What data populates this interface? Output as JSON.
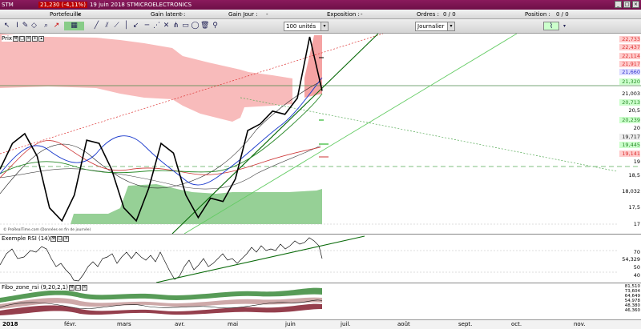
{
  "titlebar": {
    "symbol": "STM",
    "quote": "21,230 (-4,11%)",
    "info": "19 juin 2018 STMICROELECTRONICS"
  },
  "infobar": {
    "portfolio": "Portefeuille",
    "latent_gain": "Gain latent :",
    "latent_value": "-",
    "day_gain": "Gain Jour :",
    "day_value": "-",
    "exposure": "Exposition :",
    "exposure_value": "-",
    "orders": "Ordres :",
    "orders_value": "0 / 0",
    "position": "Position :",
    "position_value": "0 / 0"
  },
  "toolbar": {
    "units": "100 unités",
    "period": "Journalier"
  },
  "panels": {
    "price": "Prix",
    "rsi": "Exemple RSI (14)",
    "fibo": "Fibo_zone_rsi (9,20,2,1)",
    "credit": "© ProRealTime.com (Données en fin de journée)"
  },
  "price_axis": [
    "22,733",
    "22,437",
    "22,114",
    "21,917",
    "21,660",
    "21,320",
    "21,003",
    "20,713",
    "20,5",
    "20,239",
    "20",
    "19,717",
    "19,445",
    "19,141",
    "19",
    "18,5",
    "18,032",
    "17,5",
    "17"
  ],
  "rsi_axis": [
    "70",
    "54,329",
    "50",
    "40"
  ],
  "fibo_axis": [
    "81,510",
    "73,604",
    "64,649",
    "54,978",
    "48,380",
    "46,360"
  ],
  "months": [
    "2018",
    "févr.",
    "mars",
    "avr.",
    "mai",
    "juin",
    "juil.",
    "août",
    "sept.",
    "oct.",
    "nov."
  ],
  "chart_data": {
    "type": "line",
    "title": "STMICROELECTRONICS",
    "series": [
      {
        "name": "Prix",
        "values": [
          18.8,
          19.6,
          19.9,
          19.2,
          17.6,
          17.2,
          18.0,
          19.7,
          19.6,
          18.8,
          17.6,
          17.2,
          18.2,
          19.6,
          19.3,
          18.0,
          17.3,
          17.9,
          17.8,
          18.5,
          20.0,
          20.2,
          20.6,
          20.5,
          21.0,
          22.9,
          21.23
        ]
      }
    ],
    "ylim": [
      16.8,
      23.0
    ]
  }
}
